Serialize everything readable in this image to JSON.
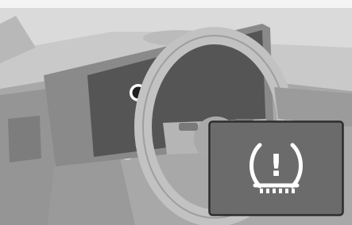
{
  "image": {
    "description_label": "",
    "indicator": {
      "icon": "tire-pressure-warning-icon",
      "symbol_text": "!"
    },
    "display_marker": {
      "icon": "circle-marker"
    }
  },
  "colors": {
    "accent": "#2f8ed3",
    "background": "#f3f3f3",
    "dark_panel": "#585858",
    "inset_bg": "#6a6a6a",
    "inset_border": "#2f2f2f",
    "icon_white": "#ffffff"
  }
}
